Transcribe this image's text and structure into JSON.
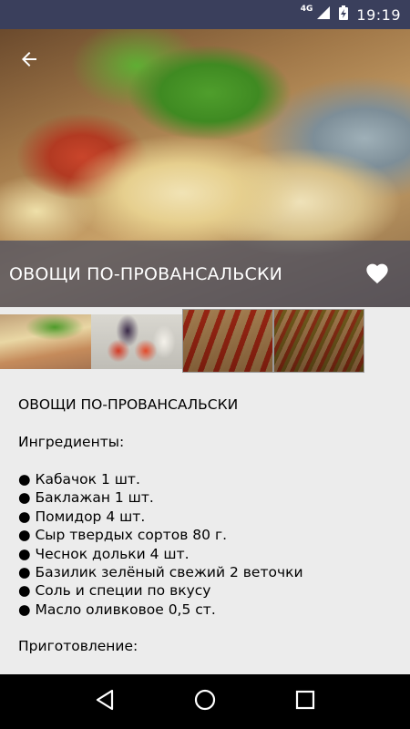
{
  "status_bar": {
    "network": "4G",
    "time": "19:19"
  },
  "hero": {
    "title": "ОВОЩИ ПО-ПРОВАНСАЛЬСКИ",
    "back_icon": "arrow-left-icon",
    "favorite_icon": "heart-icon"
  },
  "thumbnails": [
    {
      "label": "photo-1"
    },
    {
      "label": "photo-2"
    },
    {
      "label": "photo-3"
    },
    {
      "label": "photo-4"
    }
  ],
  "content": {
    "heading": "ОВОЩИ ПО-ПРОВАНСАЛЬСКИ",
    "ingredients_title": "Ингредиенты:",
    "ingredients": [
      "● Кабачок 1 шт.",
      "● Баклажан 1 шт.",
      "● Помидор 4 шт.",
      "● Сыр твердых сортов 80 г.",
      "● Чеснок дольки 4 шт.",
      "● Базилик зелёный свежий 2 веточки",
      "● Соль и специи по вкусу",
      "● Масло оливковое 0,5 ст."
    ],
    "preparation_title": "Приготовление:"
  },
  "nav": {
    "back": "triangle-back-icon",
    "home": "circle-home-icon",
    "recents": "square-recents-icon"
  },
  "colors": {
    "status_bar": "#3a3f5c",
    "title_overlay": "rgba(70,75,95,0.72)",
    "background": "#ececec"
  }
}
